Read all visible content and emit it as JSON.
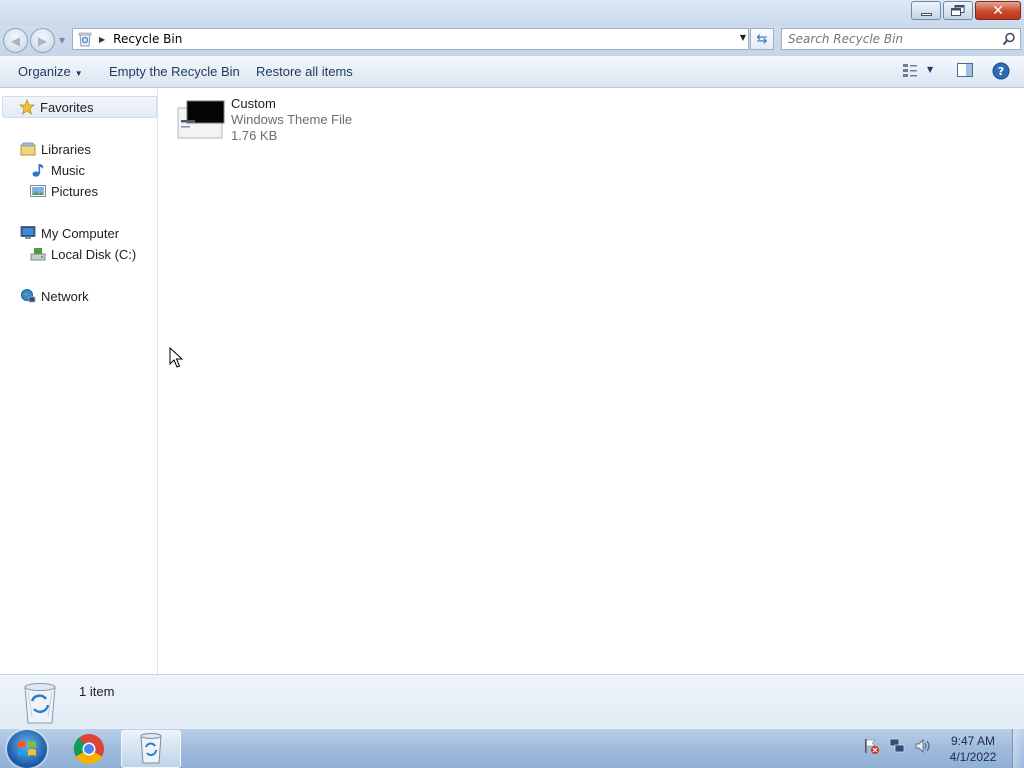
{
  "window": {
    "controls": {
      "minimize": "minimize",
      "maximize": "restore",
      "close": "close"
    }
  },
  "address": {
    "path": "Recycle Bin",
    "search_placeholder": "Search Recycle Bin"
  },
  "toolbar": {
    "organize_label": "Organize",
    "empty_label": "Empty the Recycle Bin",
    "restore_label": "Restore all items"
  },
  "sidebar": {
    "favorites": "Favorites",
    "libraries": "Libraries",
    "music": "Music",
    "pictures": "Pictures",
    "computer": "My Computer",
    "local_disk": "Local Disk (C:)",
    "network": "Network"
  },
  "files": [
    {
      "name": "Custom",
      "type": "Windows Theme File",
      "size": "1.76 KB"
    }
  ],
  "details": {
    "count": "1 item"
  },
  "taskbar": {
    "time": "9:47 AM",
    "date": "4/1/2022"
  },
  "colors": {
    "toolbar_text": "#1e395b",
    "accent": "#2d6fb3"
  }
}
